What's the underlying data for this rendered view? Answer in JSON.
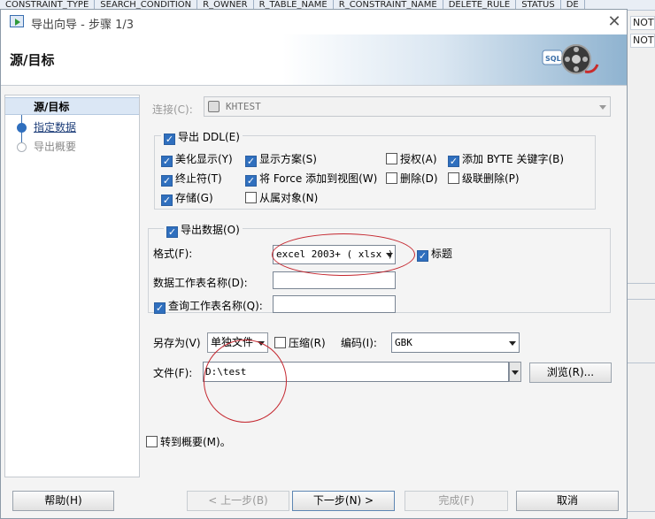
{
  "background": {
    "columns": [
      "CONSTRAINT_TYPE",
      "SEARCH_CONDITION",
      "R_OWNER",
      "R_TABLE_NAME",
      "R_CONSTRAINT_NAME",
      "DELETE_RULE",
      "STATUS",
      "DE"
    ],
    "cells": [
      "NOT",
      "NOT"
    ]
  },
  "dialog": {
    "title": "导出向导 - 步骤 1/3",
    "close_glyph": "✕",
    "header_title": "源/目标"
  },
  "nav": {
    "items": [
      {
        "label": "源/目标",
        "state": "current"
      },
      {
        "label": "指定数据",
        "state": "link"
      },
      {
        "label": "导出概要",
        "state": "disabled"
      }
    ]
  },
  "form": {
    "connection": {
      "label": "连接(C):",
      "value": "KHTEST"
    },
    "export_ddl": {
      "label": "导出 DDL(E)",
      "checked": true
    },
    "ddl_options": [
      {
        "label": "美化显示(Y)",
        "checked": true
      },
      {
        "label": "显示方案(S)",
        "checked": true
      },
      {
        "label": "授权(A)",
        "checked": false
      },
      {
        "label": "添加 BYTE 关键字(B)",
        "checked": true
      },
      {
        "label": "终止符(T)",
        "checked": true
      },
      {
        "label": "将 Force 添加到视图(W)",
        "checked": true
      },
      {
        "label": "删除(D)",
        "checked": false
      },
      {
        "label": "级联删除(P)",
        "checked": false
      },
      {
        "label": "存储(G)",
        "checked": true
      },
      {
        "label": "从属对象(N)",
        "checked": false
      }
    ],
    "export_data": {
      "label": "导出数据(O)",
      "checked": true
    },
    "format": {
      "label": "格式(F):",
      "value": "excel 2003+ ( xlsx )"
    },
    "header_option": {
      "label": "标题",
      "checked": true
    },
    "data_sheet": {
      "label": "数据工作表名称(D):",
      "value": ""
    },
    "query_sheet": {
      "label": "查询工作表名称(Q):",
      "value": "",
      "checked": true
    },
    "save_as": {
      "label": "另存为(V)",
      "value": "单独文件"
    },
    "compress": {
      "label": "压缩(R)",
      "checked": false
    },
    "encoding": {
      "label": "编码(I):",
      "value": "GBK"
    },
    "file": {
      "label": "文件(F):",
      "value": "D:\\test"
    },
    "browse_label": "浏览(R)...",
    "goto_summary": {
      "label": "转到概要(M)。",
      "checked": false
    }
  },
  "buttons": {
    "help": "帮助(H)",
    "back": "< 上一步(B)",
    "next": "下一步(N) >",
    "finish": "完成(F)",
    "cancel": "取消"
  },
  "colors": {
    "accent": "#2f6fbe",
    "annotation": "#c4262e",
    "nav_selected": "#dbe7f5"
  }
}
